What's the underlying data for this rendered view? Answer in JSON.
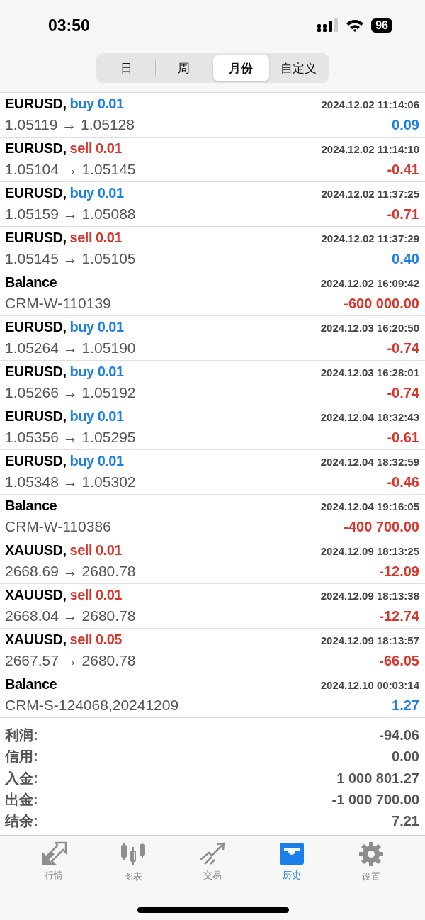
{
  "status_bar": {
    "time": "03:50",
    "battery": "96"
  },
  "period_tabs": [
    {
      "label": "日",
      "selected": false
    },
    {
      "label": "周",
      "selected": false
    },
    {
      "label": "月份",
      "selected": true
    },
    {
      "label": "自定义",
      "selected": false
    }
  ],
  "deals": [
    {
      "kind": "trade",
      "symbol": "EURUSD,",
      "side": "buy",
      "volume": "0.01",
      "time": "2024.12.02 11:14:06",
      "prices": "1.05119 → 1.05128",
      "profit": "0.09",
      "color": "#1a7fe8"
    },
    {
      "kind": "trade",
      "symbol": "EURUSD,",
      "side": "sell",
      "volume": "0.01",
      "time": "2024.12.02 11:14:10",
      "prices": "1.05104 → 1.05145",
      "profit": "-0.41",
      "color": "#d9352b"
    },
    {
      "kind": "trade",
      "symbol": "EURUSD,",
      "side": "buy",
      "volume": "0.01",
      "time": "2024.12.02 11:37:25",
      "prices": "1.05159 → 1.05088",
      "profit": "-0.71",
      "color": "#d9352b"
    },
    {
      "kind": "trade",
      "symbol": "EURUSD,",
      "side": "sell",
      "volume": "0.01",
      "time": "2024.12.02 11:37:29",
      "prices": "1.05145 → 1.05105",
      "profit": "0.40",
      "color": "#1a7fe8"
    },
    {
      "kind": "balance",
      "symbol": "Balance",
      "time": "2024.12.02 16:09:42",
      "prices": "CRM-W-110139",
      "profit": "-600 000.00",
      "color": "#d9352b"
    },
    {
      "kind": "trade",
      "symbol": "EURUSD,",
      "side": "buy",
      "volume": "0.01",
      "time": "2024.12.03 16:20:50",
      "prices": "1.05264 → 1.05190",
      "profit": "-0.74",
      "color": "#d9352b"
    },
    {
      "kind": "trade",
      "symbol": "EURUSD,",
      "side": "buy",
      "volume": "0.01",
      "time": "2024.12.03 16:28:01",
      "prices": "1.05266 → 1.05192",
      "profit": "-0.74",
      "color": "#d9352b"
    },
    {
      "kind": "trade",
      "symbol": "EURUSD,",
      "side": "buy",
      "volume": "0.01",
      "time": "2024.12.04 18:32:43",
      "prices": "1.05356 → 1.05295",
      "profit": "-0.61",
      "color": "#d9352b"
    },
    {
      "kind": "trade",
      "symbol": "EURUSD,",
      "side": "buy",
      "volume": "0.01",
      "time": "2024.12.04 18:32:59",
      "prices": "1.05348 → 1.05302",
      "profit": "-0.46",
      "color": "#d9352b"
    },
    {
      "kind": "balance",
      "symbol": "Balance",
      "time": "2024.12.04 19:16:05",
      "prices": "CRM-W-110386",
      "profit": "-400 700.00",
      "color": "#d9352b"
    },
    {
      "kind": "trade",
      "symbol": "XAUUSD,",
      "side": "sell",
      "volume": "0.01",
      "time": "2024.12.09 18:13:25",
      "prices": "2668.69 → 2680.78",
      "profit": "-12.09",
      "color": "#d9352b"
    },
    {
      "kind": "trade",
      "symbol": "XAUUSD,",
      "side": "sell",
      "volume": "0.01",
      "time": "2024.12.09 18:13:38",
      "prices": "2668.04 → 2680.78",
      "profit": "-12.74",
      "color": "#d9352b"
    },
    {
      "kind": "trade",
      "symbol": "XAUUSD,",
      "side": "sell",
      "volume": "0.05",
      "time": "2024.12.09 18:13:57",
      "prices": "2667.57 → 2680.78",
      "profit": "-66.05",
      "color": "#d9352b"
    },
    {
      "kind": "balance",
      "symbol": "Balance",
      "time": "2024.12.10 00:03:14",
      "prices": "CRM-S-124068,20241209",
      "profit": "1.27",
      "color": "#1a7fe8"
    }
  ],
  "summary": [
    {
      "label": "利润:",
      "value": "-94.06"
    },
    {
      "label": "信用:",
      "value": "0.00"
    },
    {
      "label": "入金:",
      "value": "1 000 801.27"
    },
    {
      "label": "出金:",
      "value": "-1 000 700.00"
    },
    {
      "label": "结余:",
      "value": "7.21"
    }
  ],
  "tab_bar": [
    {
      "kind": "quotes",
      "label": "行情",
      "selected": false
    },
    {
      "kind": "chart",
      "label": "图表",
      "selected": false
    },
    {
      "kind": "trade",
      "label": "交易",
      "selected": false
    },
    {
      "kind": "history",
      "label": "历史",
      "selected": true
    },
    {
      "kind": "settings",
      "label": "设置",
      "selected": false
    }
  ]
}
